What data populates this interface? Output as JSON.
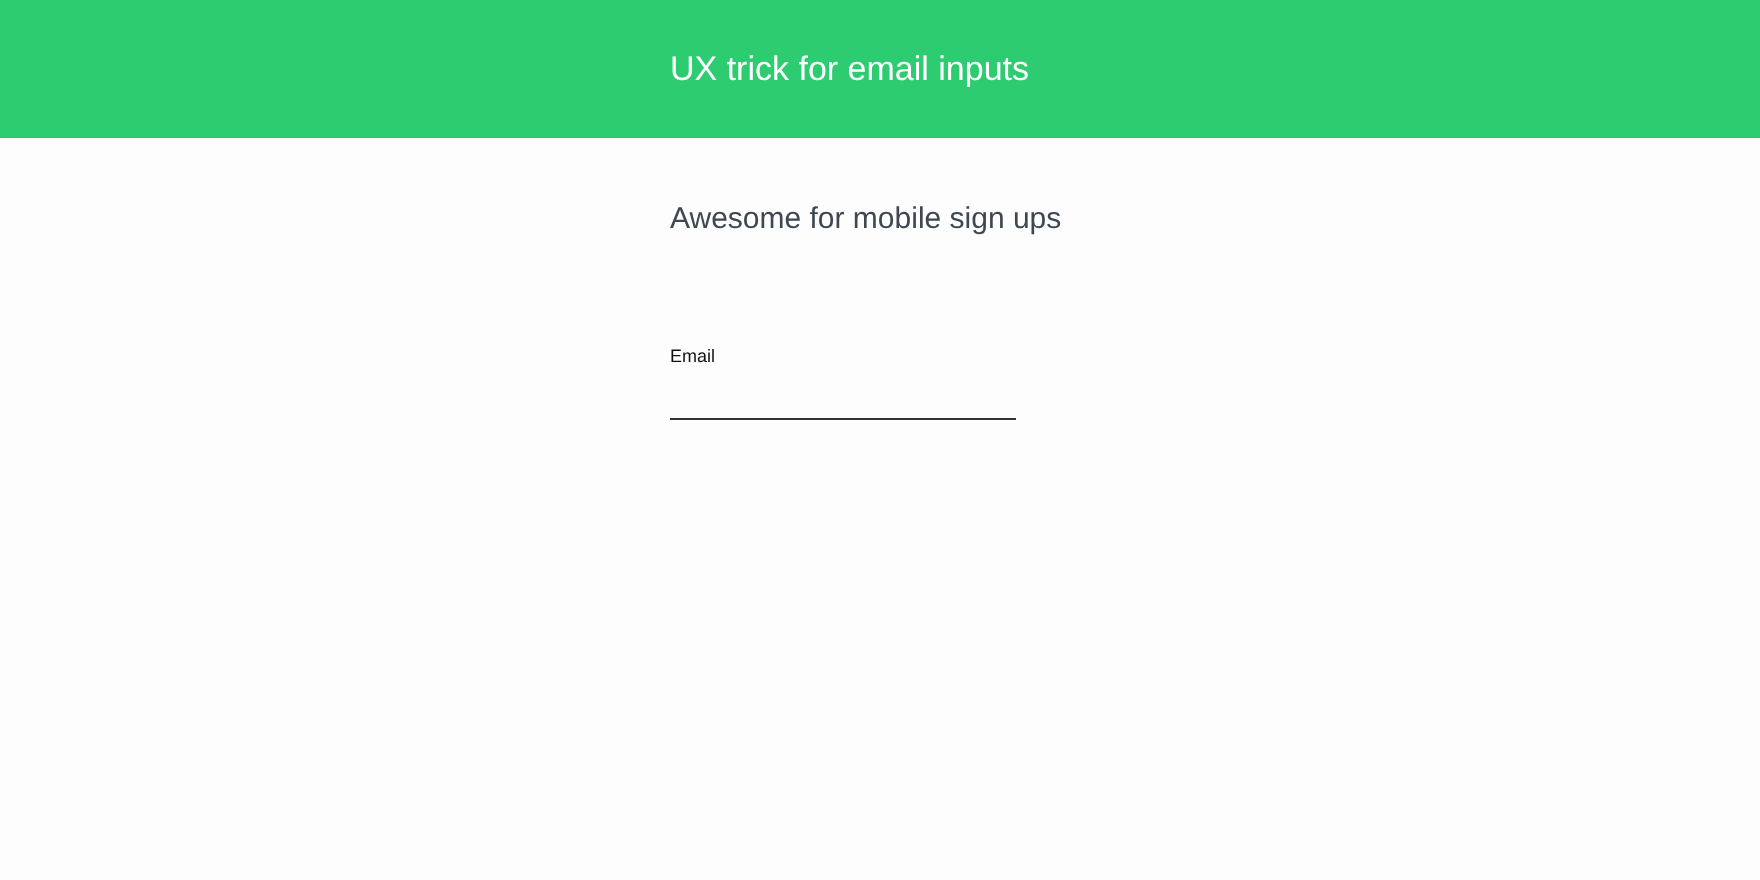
{
  "header": {
    "title": "UX trick for email inputs"
  },
  "subtitle": "Awesome for mobile sign ups",
  "email_field": {
    "label": "Email"
  }
}
